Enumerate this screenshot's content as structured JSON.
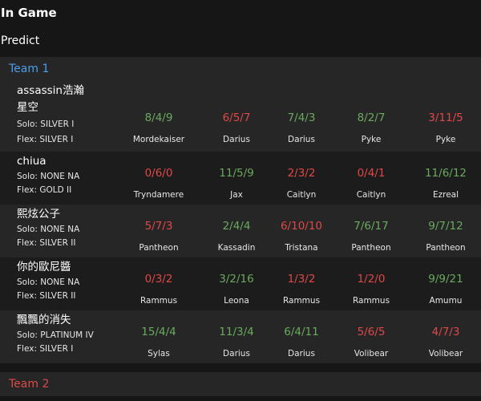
{
  "header": {
    "title": "In Game",
    "predict_label": "Predict"
  },
  "teams": [
    {
      "label": "Team 1",
      "color": "#4a9eea"
    },
    {
      "label": "Team 2",
      "color": "#e04848"
    }
  ],
  "colors": {
    "win": "#6aaa5e",
    "loss": "#e04848",
    "background": "#161616"
  },
  "players": [
    {
      "name": "assassin浩瀚星空",
      "solo": "Solo: SILVER I",
      "flex": "Flex: SILVER I",
      "matches": [
        {
          "kda": "8/4/9",
          "result": "win",
          "champion": "Mordekaiser"
        },
        {
          "kda": "6/5/7",
          "result": "loss",
          "champion": "Darius"
        },
        {
          "kda": "7/4/3",
          "result": "win",
          "champion": "Darius"
        },
        {
          "kda": "8/2/7",
          "result": "win",
          "champion": "Pyke"
        },
        {
          "kda": "3/11/5",
          "result": "loss",
          "champion": "Pyke"
        }
      ]
    },
    {
      "name": "chiua",
      "solo": "Solo: NONE NA",
      "flex": "Flex: GOLD II",
      "matches": [
        {
          "kda": "0/6/0",
          "result": "loss",
          "champion": "Tryndamere"
        },
        {
          "kda": "11/5/9",
          "result": "win",
          "champion": "Jax"
        },
        {
          "kda": "2/3/2",
          "result": "loss",
          "champion": "Caitlyn"
        },
        {
          "kda": "0/4/1",
          "result": "loss",
          "champion": "Caitlyn"
        },
        {
          "kda": "11/6/12",
          "result": "win",
          "champion": "Ezreal"
        }
      ]
    },
    {
      "name": "熙炫公子",
      "solo": "Solo: NONE NA",
      "flex": "Flex: SILVER II",
      "matches": [
        {
          "kda": "5/7/3",
          "result": "loss",
          "champion": "Pantheon"
        },
        {
          "kda": "2/4/4",
          "result": "win",
          "champion": "Kassadin"
        },
        {
          "kda": "6/10/10",
          "result": "loss",
          "champion": "Tristana"
        },
        {
          "kda": "7/6/17",
          "result": "win",
          "champion": "Pantheon"
        },
        {
          "kda": "9/7/12",
          "result": "win",
          "champion": "Pantheon"
        }
      ]
    },
    {
      "name": "你的歐尼醬",
      "solo": "Solo: NONE NA",
      "flex": "Flex: SILVER II",
      "matches": [
        {
          "kda": "0/3/2",
          "result": "loss",
          "champion": "Rammus"
        },
        {
          "kda": "3/2/16",
          "result": "win",
          "champion": "Leona"
        },
        {
          "kda": "1/3/2",
          "result": "loss",
          "champion": "Rammus"
        },
        {
          "kda": "1/2/0",
          "result": "loss",
          "champion": "Rammus"
        },
        {
          "kda": "9/9/21",
          "result": "win",
          "champion": "Amumu"
        }
      ]
    },
    {
      "name": "飄飄的消失",
      "solo": "Solo: PLATINUM IV",
      "flex": "Flex: SILVER I",
      "matches": [
        {
          "kda": "15/4/4",
          "result": "win",
          "champion": "Sylas"
        },
        {
          "kda": "11/3/4",
          "result": "win",
          "champion": "Darius"
        },
        {
          "kda": "6/4/11",
          "result": "win",
          "champion": "Darius"
        },
        {
          "kda": "5/6/5",
          "result": "loss",
          "champion": "Volibear"
        },
        {
          "kda": "4/7/3",
          "result": "loss",
          "champion": "Volibear"
        }
      ]
    }
  ]
}
